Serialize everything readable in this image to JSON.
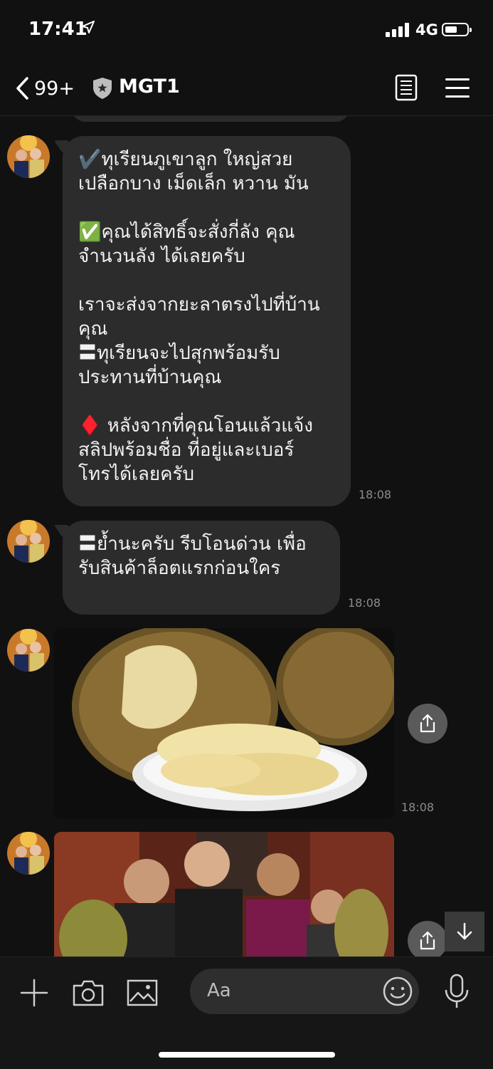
{
  "status_bar": {
    "time": "17:41",
    "network": "4G"
  },
  "header": {
    "back_count": "99+",
    "title": "MGT1"
  },
  "messages": [
    {
      "text": "✔️ทุเรียนภูเขาลูก ใหญ่สวย\nเปลือกบาง เม็ดเล็ก หวาน มัน\n\n✅คุณได้สิทธิ์จะสั่งกี่ลัง คุณ\nจำนวนลัง ได้เลยครับ\n\nเราจะส่งจากยะลาตรงไปที่บ้าน\nคุณ\n〓ทุเรียนจะไปสุกพร้อมรับ\nประทานที่บ้านคุณ\n\n♦️ หลังจากที่คุณโอนแล้วแจ้ง\nสลิปพร้อมชื่อ ที่อยู่และเบอร์\nโทรได้เลยครับ",
      "time": "18:08"
    },
    {
      "text": "〓ย้ำนะครับ รีบโอนด่วน เพื่อ\nรับสินค้าล็อตแรกก่อนใคร",
      "time": "18:08"
    },
    {
      "image": "durian-photo",
      "time": "18:08"
    },
    {
      "image": "group-photo-with-durians",
      "time": ""
    }
  ],
  "composer": {
    "placeholder": "Aa"
  },
  "colors": {
    "background": "#111111",
    "bubble": "#2c2c2c",
    "timestamp": "#8c8c8c"
  }
}
